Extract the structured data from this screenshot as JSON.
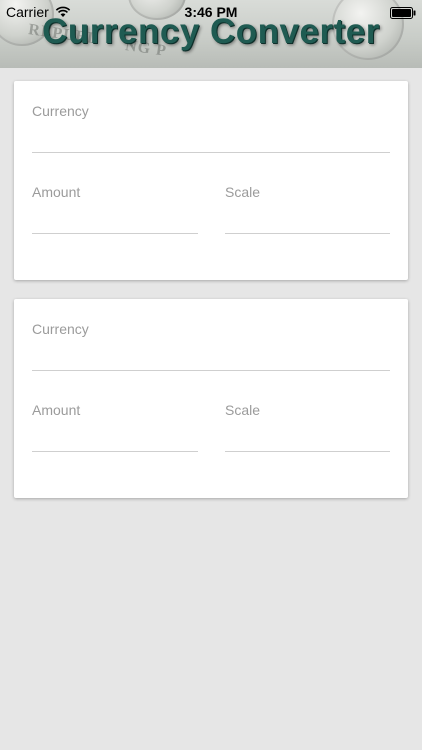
{
  "status_bar": {
    "carrier": "Carrier",
    "time": "3:46 PM",
    "wifi_icon": "wifi-icon",
    "battery_icon": "battery-icon"
  },
  "header": {
    "title": "Currency Converter",
    "background_text_1": "REPUBL",
    "background_text_2": "NG P",
    "title_color": "#1f5b52"
  },
  "converter_cards": [
    {
      "currency": {
        "label": "Currency",
        "value": "",
        "placeholder": ""
      },
      "amount": {
        "label": "Amount",
        "value": "",
        "placeholder": ""
      },
      "scale": {
        "label": "Scale",
        "value": "",
        "placeholder": ""
      }
    },
    {
      "currency": {
        "label": "Currency",
        "value": "",
        "placeholder": ""
      },
      "amount": {
        "label": "Amount",
        "value": "",
        "placeholder": ""
      },
      "scale": {
        "label": "Scale",
        "value": "",
        "placeholder": ""
      }
    }
  ],
  "colors": {
    "background": "#e6e6e6",
    "card": "#ffffff",
    "label": "#9b9b9b",
    "underline": "#cfcfcf"
  }
}
